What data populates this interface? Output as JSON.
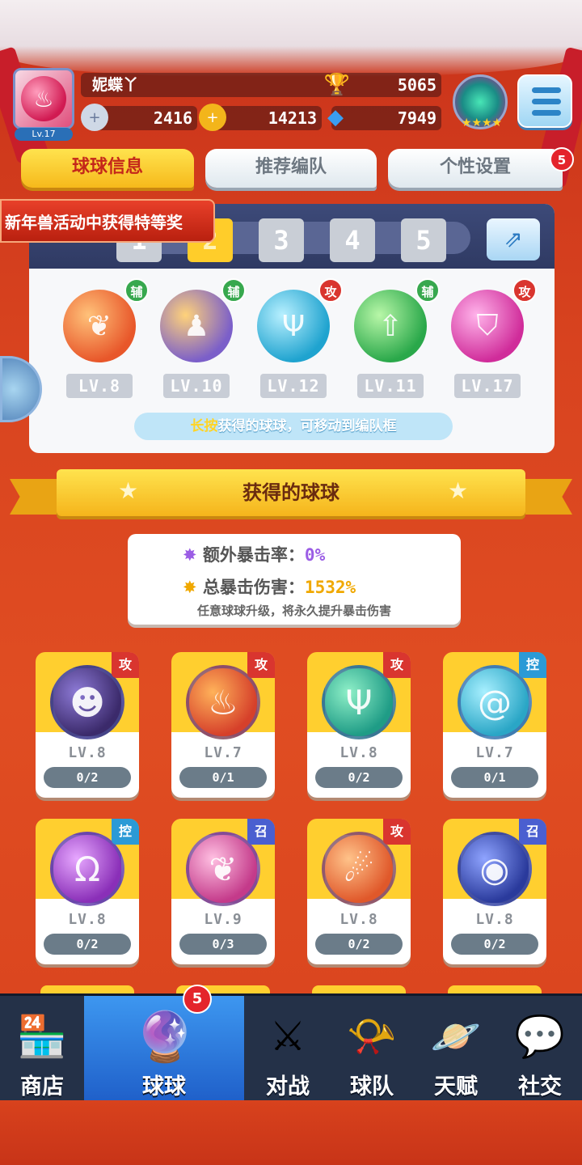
{
  "header": {
    "player_name": "妮蝶丫",
    "level": "Lv.17",
    "trophies": "5065",
    "stamina": "2416",
    "coins": "14213",
    "diamonds": "7949"
  },
  "tabs": [
    {
      "label": "球球信息",
      "active": true
    },
    {
      "label": "推荐编队",
      "active": false
    },
    {
      "label": "个性设置",
      "active": false,
      "badge": "5"
    }
  ],
  "event_banner": "新年兽活动中获得特等奖",
  "team": {
    "slots": [
      "1",
      "2",
      "3",
      "4",
      "5"
    ],
    "selected_slot": "2",
    "members": [
      {
        "role": "辅",
        "level": "LV.8",
        "icon": "phoenix-wings-icon",
        "color": "#e8572a"
      },
      {
        "role": "辅",
        "level": "LV.10",
        "icon": "people-icon",
        "color": "#7b5fc9"
      },
      {
        "role": "攻",
        "level": "LV.12",
        "icon": "trident-icon",
        "color": "#1fa3cf"
      },
      {
        "role": "辅",
        "level": "LV.11",
        "icon": "arrow-up-icon",
        "color": "#2aa84a"
      },
      {
        "role": "攻",
        "level": "LV.17",
        "icon": "broken-shield-icon",
        "color": "#d02c9a"
      }
    ],
    "hint_highlight": "长按",
    "hint_text": "获得的球球，可移动到编队框"
  },
  "obtained_title": "获得的球球",
  "crit": {
    "extra_label": "额外暴击率：",
    "extra_value": "0%",
    "total_label": "总暴击伤害：",
    "total_value": "1532%",
    "note": "任意球球升级，将永久提升暴击伤害"
  },
  "balls": [
    {
      "type": "攻",
      "level": "LV.8",
      "progress": "0/2",
      "icon": "venom-face-icon",
      "color": "#3b2a6b"
    },
    {
      "type": "攻",
      "level": "LV.7",
      "progress": "0/1",
      "icon": "fire-dragon-icon",
      "color": "#d6402a"
    },
    {
      "type": "攻",
      "level": "LV.8",
      "progress": "0/2",
      "icon": "trident-icon",
      "color": "#1f9c86"
    },
    {
      "type": "控",
      "level": "LV.7",
      "progress": "0/1",
      "icon": "tornado-icon",
      "color": "#2aa6c6"
    },
    {
      "type": "控",
      "level": "LV.8",
      "progress": "0/2",
      "icon": "void-icon",
      "color": "#8a2fb8"
    },
    {
      "type": "召",
      "level": "LV.9",
      "progress": "0/3",
      "icon": "phoenix-icon",
      "color": "#c43a8a"
    },
    {
      "type": "攻",
      "level": "LV.8",
      "progress": "0/2",
      "icon": "meteor-icon",
      "color": "#e0582a"
    },
    {
      "type": "召",
      "level": "LV.8",
      "progress": "0/2",
      "icon": "black-hole-icon",
      "color": "#2a3a9c"
    }
  ],
  "nav": [
    {
      "label": "商店",
      "icon": "shop-icon",
      "active": false
    },
    {
      "label": "球球",
      "icon": "ball-icon",
      "active": true,
      "badge": "5"
    },
    {
      "label": "对战",
      "icon": "crossed-swords-icon",
      "active": false
    },
    {
      "label": "球队",
      "icon": "whistle-icon",
      "active": false
    },
    {
      "label": "天赋",
      "icon": "planet-icon",
      "active": false
    },
    {
      "label": "社交",
      "icon": "chat-heart-icon",
      "active": false
    }
  ]
}
